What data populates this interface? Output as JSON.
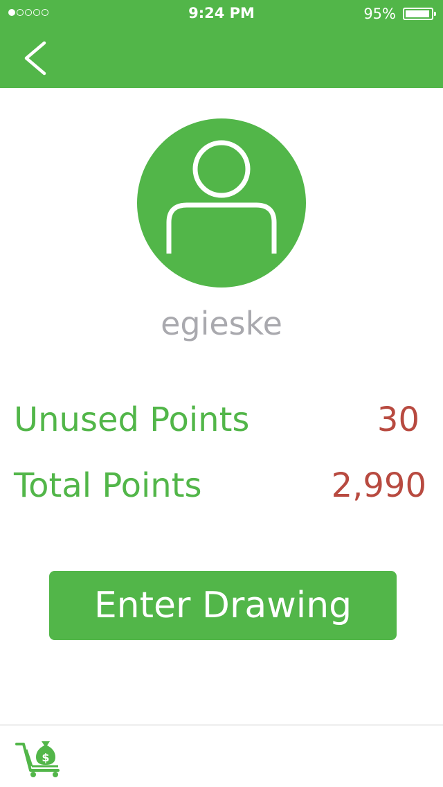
{
  "status_bar": {
    "time": "9:24 PM",
    "battery_percent": "95%",
    "battery_level": 0.95,
    "signal_strength": 1,
    "signal_max": 5
  },
  "header": {
    "back_icon": "chevron-left-icon"
  },
  "profile": {
    "avatar_icon": "user-icon",
    "username": "egieske"
  },
  "stats": {
    "unused_label": "Unused Points",
    "unused_value": "30",
    "total_label": "Total Points",
    "total_value": "2,990"
  },
  "actions": {
    "enter_drawing_label": "Enter Drawing"
  },
  "bottom_bar": {
    "cart_icon": "shopping-cart-money-bag-icon"
  },
  "colors": {
    "accent_green": "#52b649",
    "value_red": "#b84a40",
    "username_gray": "#a9a9ae"
  }
}
